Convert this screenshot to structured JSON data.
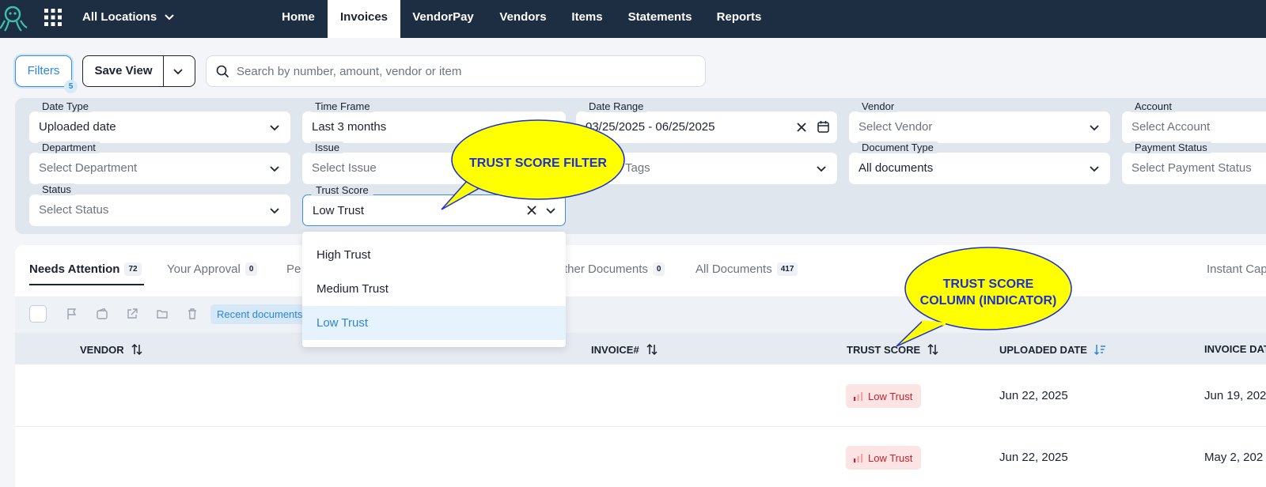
{
  "nav": {
    "location": "All Locations",
    "tabs": [
      "Home",
      "Invoices",
      "VendorPay",
      "Vendors",
      "Items",
      "Statements",
      "Reports"
    ],
    "active_tab": "Invoices"
  },
  "toolbar": {
    "filters_label": "Filters",
    "filters_count": "5",
    "save_view_label": "Save View",
    "search_placeholder": "Search by number, amount, vendor or item"
  },
  "filters": {
    "date_type": {
      "label": "Date Type",
      "value": "Uploaded date"
    },
    "time_frame": {
      "label": "Time Frame",
      "value": "Last 3 months"
    },
    "date_range": {
      "label": "Date Range",
      "value": "03/25/2025 - 06/25/2025"
    },
    "vendor": {
      "label": "Vendor",
      "placeholder": "Select Vendor"
    },
    "account": {
      "label": "Account",
      "placeholder": "Select Account"
    },
    "department": {
      "label": "Department",
      "placeholder": "Select Department"
    },
    "issue": {
      "label": "Issue",
      "placeholder": "Select Issue"
    },
    "tags": {
      "placeholder": "Tags"
    },
    "document_type": {
      "label": "Document Type",
      "value": "All documents"
    },
    "payment_status": {
      "label": "Payment Status",
      "placeholder": "Select Payment Status"
    },
    "status": {
      "label": "Status",
      "placeholder": "Select Status"
    },
    "trust_score": {
      "label": "Trust Score",
      "value": "Low Trust"
    }
  },
  "trust_dropdown": {
    "options": [
      "High Trust",
      "Medium Trust",
      "Low Trust"
    ],
    "selected": "Low Trust"
  },
  "tabs": [
    {
      "label": "Needs Attention",
      "count": "72"
    },
    {
      "label": "Your Approval",
      "count": "0"
    },
    {
      "label": "Pe"
    },
    {
      "label": "ther Documents",
      "count": "0"
    },
    {
      "label": "All Documents",
      "count": "417"
    },
    {
      "label": "Instant Cap"
    }
  ],
  "actions": {
    "chip": "Recent documents"
  },
  "columns": {
    "vendor": "VENDOR",
    "invoice": "INVOICE#",
    "trust_score": "TRUST SCORE",
    "uploaded_date": "UPLOADED DATE",
    "invoice_date": "INVOICE DAT"
  },
  "rows": [
    {
      "trust": "Low Trust",
      "uploaded": "Jun 22, 2025",
      "invoice_date": "Jun 19, 202"
    },
    {
      "trust": "Low Trust",
      "uploaded": "Jun 22, 2025",
      "invoice_date": "May 2, 202"
    }
  ],
  "callouts": {
    "filter": "TRUST SCORE FILTER",
    "column_line1": "TRUST SCORE",
    "column_line2": "COLUMN (INDICATOR)"
  },
  "colors": {
    "nav_bg": "#1d2d42",
    "accent": "#2b86dc",
    "callout_fill": "#ffff00",
    "callout_text": "#1a2fd6",
    "low_trust": "#c8222a"
  }
}
